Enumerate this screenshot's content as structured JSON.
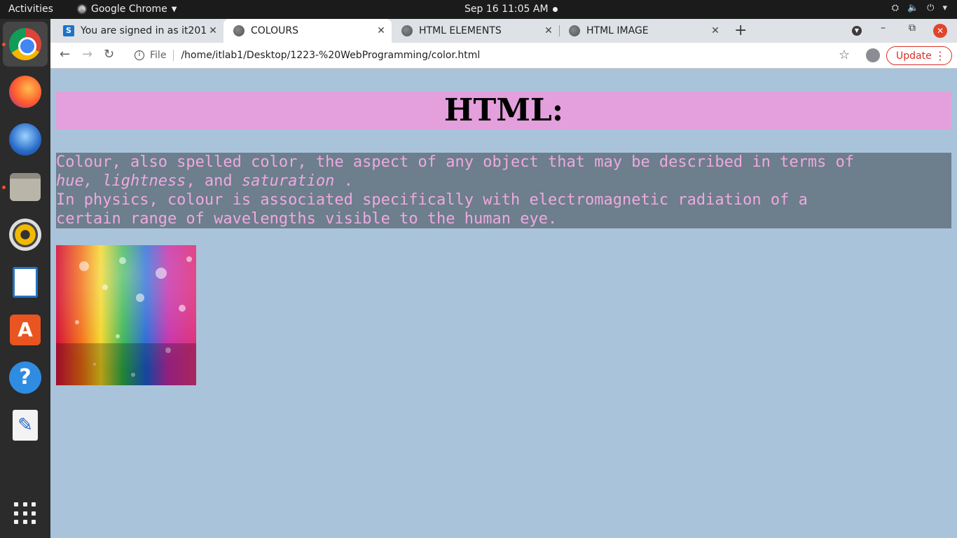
{
  "topbar": {
    "activities": "Activities",
    "app_name": "Google Chrome",
    "clock": "Sep 16  11:05 AM"
  },
  "dock": {
    "items": [
      "chrome",
      "firefox",
      "thunderbird",
      "files",
      "rhythmbox",
      "libreoffice-writer",
      "ubuntu-software",
      "help",
      "text-editor"
    ]
  },
  "tabs": [
    {
      "label": "You are signed in as it201",
      "active": false
    },
    {
      "label": "COLOURS",
      "active": true
    },
    {
      "label": "HTML ELEMENTS",
      "active": false
    },
    {
      "label": "HTML IMAGE",
      "active": false
    }
  ],
  "toolbar": {
    "scheme": "File",
    "url": "/home/itlab1/Desktop/1223-%20WebProgramming/color.html",
    "update_label": "Update"
  },
  "page": {
    "heading": "HTML:",
    "para_line1": "Colour, also spelled color, the aspect of any object that may be described in terms of",
    "para_italic_1": "hue, lightness",
    "para_mid": ", and ",
    "para_italic_2": "saturation",
    "para_end": " .",
    "para_line3": "In physics, colour is associated specifically with electromagnetic radiation of a",
    "para_line4": "certain range of wavelengths visible to the human eye."
  },
  "colors": {
    "page_bg": "#a9c3db",
    "heading_bg": "#e3a0dc",
    "para_bg": "#6d7e8c",
    "para_text": "#eea9e0",
    "update_red": "#d93025"
  }
}
